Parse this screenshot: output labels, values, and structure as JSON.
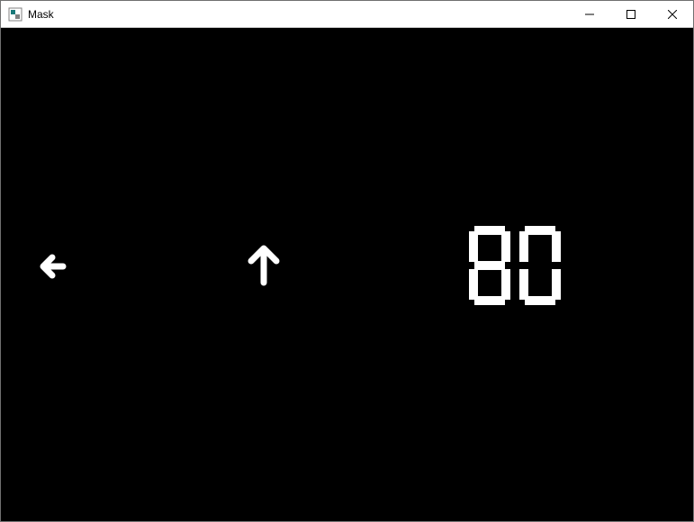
{
  "window": {
    "title": "Mask"
  },
  "content": {
    "arrow_left_icon": "arrow-left",
    "arrow_up_icon": "arrow-up",
    "readout_value": "80",
    "digits": [
      "8",
      "0"
    ]
  },
  "colors": {
    "content_bg": "#000000",
    "content_fg": "#ffffff",
    "titlebar_bg": "#ffffff"
  }
}
